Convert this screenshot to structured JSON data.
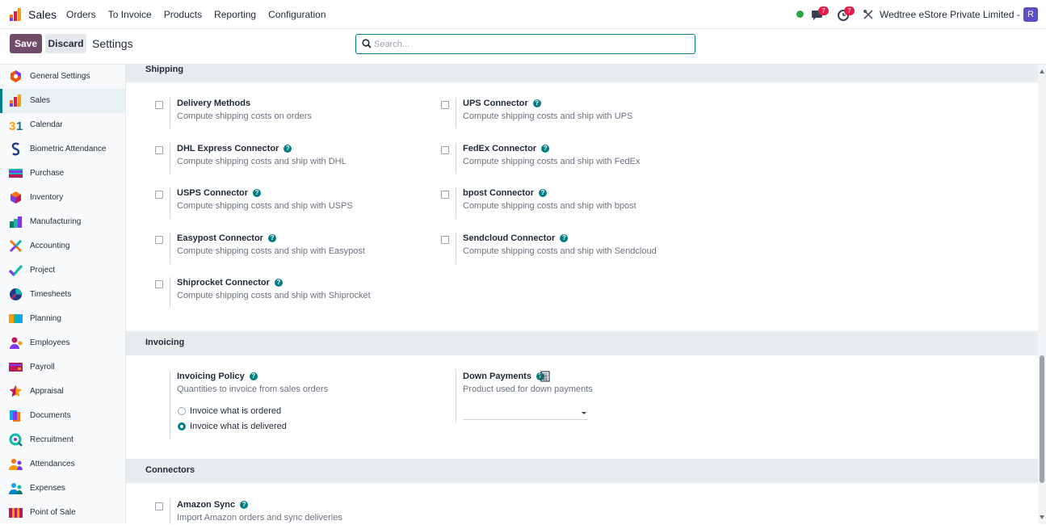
{
  "app": {
    "name": "Sales",
    "logo_icon": "sales-bar-chart-icon"
  },
  "menu": [
    "Orders",
    "To Invoice",
    "Products",
    "Reporting",
    "Configuration"
  ],
  "navbar": {
    "messages_count": "7",
    "activities_count": "7",
    "company": "Wedtree eStore Private Limited - HO",
    "avatar_initial": "R",
    "status_color": "#28a745"
  },
  "toolbar": {
    "save_label": "Save",
    "discard_label": "Discard",
    "title": "Settings"
  },
  "search": {
    "placeholder": "Search...",
    "value": ""
  },
  "sidebar": {
    "items": [
      {
        "label": "General Settings",
        "icon": "general-settings-icon"
      },
      {
        "label": "Sales",
        "icon": "sales-icon",
        "active": true
      },
      {
        "label": "Calendar",
        "icon": "calendar-icon"
      },
      {
        "label": "Biometric Attendance",
        "icon": "biometric-icon"
      },
      {
        "label": "Purchase",
        "icon": "purchase-icon"
      },
      {
        "label": "Inventory",
        "icon": "inventory-icon"
      },
      {
        "label": "Manufacturing",
        "icon": "manufacturing-icon"
      },
      {
        "label": "Accounting",
        "icon": "accounting-icon"
      },
      {
        "label": "Project",
        "icon": "project-icon"
      },
      {
        "label": "Timesheets",
        "icon": "timesheets-icon"
      },
      {
        "label": "Planning",
        "icon": "planning-icon"
      },
      {
        "label": "Employees",
        "icon": "employees-icon"
      },
      {
        "label": "Payroll",
        "icon": "payroll-icon"
      },
      {
        "label": "Appraisal",
        "icon": "appraisal-icon"
      },
      {
        "label": "Documents",
        "icon": "documents-icon"
      },
      {
        "label": "Recruitment",
        "icon": "recruitment-icon"
      },
      {
        "label": "Attendances",
        "icon": "attendances-icon"
      },
      {
        "label": "Expenses",
        "icon": "expenses-icon"
      },
      {
        "label": "Point of Sale",
        "icon": "point-of-sale-icon"
      }
    ]
  },
  "shipping": {
    "heading": "Shipping",
    "settings": [
      {
        "title": "Delivery Methods",
        "desc": "Compute shipping costs on orders",
        "help": false,
        "checked": false
      },
      {
        "title": "UPS Connector",
        "desc": "Compute shipping costs and ship with UPS",
        "help": true,
        "checked": false
      },
      {
        "title": "DHL Express Connector",
        "desc": "Compute shipping costs and ship with DHL",
        "help": true,
        "checked": false
      },
      {
        "title": "FedEx Connector",
        "desc": "Compute shipping costs and ship with FedEx",
        "help": true,
        "checked": false
      },
      {
        "title": "USPS Connector",
        "desc": "Compute shipping costs and ship with USPS",
        "help": true,
        "checked": false
      },
      {
        "title": "bpost Connector",
        "desc": "Compute shipping costs and ship with bpost",
        "help": true,
        "checked": false
      },
      {
        "title": "Easypost Connector",
        "desc": "Compute shipping costs and ship with Easypost",
        "help": true,
        "checked": false
      },
      {
        "title": "Sendcloud Connector",
        "desc": "Compute shipping costs and ship with Sendcloud",
        "help": true,
        "checked": false
      },
      {
        "title": "Shiprocket Connector",
        "desc": "Compute shipping costs and ship with Shiprocket",
        "help": true,
        "checked": false
      }
    ]
  },
  "invoicing": {
    "heading": "Invoicing",
    "policy": {
      "title": "Invoicing Policy",
      "desc": "Quantities to invoice from sales orders",
      "options": [
        "Invoice what is ordered",
        "Invoice what is delivered"
      ],
      "selected": "Invoice what is delivered"
    },
    "down_payments": {
      "title": "Down Payments",
      "desc": "Product used for down payments",
      "value": ""
    }
  },
  "connectors": {
    "heading": "Connectors",
    "settings": [
      {
        "title": "Amazon Sync",
        "desc": "Import Amazon orders and sync deliveries",
        "help": true,
        "checked": false
      }
    ]
  },
  "help_glyph": "?",
  "colors": {
    "brand": "#714b67",
    "accent": "#017e84",
    "badge": "#e11d48"
  }
}
